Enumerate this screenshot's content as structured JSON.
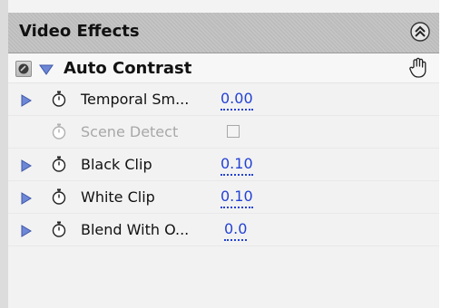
{
  "panel": {
    "title": "Video Effects",
    "collapse_icon": "double-chevron-up-icon"
  },
  "effect": {
    "name": "Auto Contrast",
    "toggle_icon": "fx-toggle-icon",
    "twirl_icon": "triangle-down-icon",
    "hand_icon": "hand-cursor-icon"
  },
  "params": [
    {
      "label": "Temporal Sm...",
      "value": "0.00",
      "enabled": true,
      "has_twirl": true
    },
    {
      "label": "Scene Detect",
      "value": "",
      "enabled": false,
      "has_twirl": false,
      "checkbox": true,
      "checked": false
    },
    {
      "label": "Black Clip",
      "value": "0.10",
      "enabled": true,
      "has_twirl": true
    },
    {
      "label": "White Clip",
      "value": "0.10",
      "enabled": true,
      "has_twirl": true
    },
    {
      "label": "Blend With O...",
      "value": "0.0",
      "enabled": true,
      "has_twirl": true
    }
  ],
  "colors": {
    "value_blue": "#2442d4",
    "twirl_blue": "#6d87d6",
    "header_gray": "#bcbcbc"
  }
}
